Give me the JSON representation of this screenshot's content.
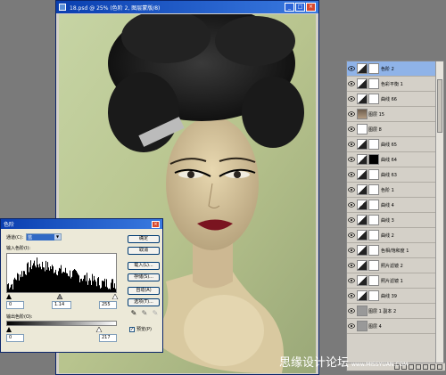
{
  "document": {
    "title": "18.psd @ 25% (色阶 2, 图层蒙版/8)",
    "controls": {
      "minimize": "_",
      "maximize": "□",
      "close": "×"
    }
  },
  "layers": {
    "items": [
      {
        "label": "色阶 2",
        "thumb": "adj",
        "mask": "white",
        "selected": true
      },
      {
        "label": "色彩平衡 1",
        "thumb": "adj",
        "mask": "white",
        "selected": false
      },
      {
        "label": "曲线 66",
        "thumb": "adj",
        "mask": "white",
        "selected": false
      },
      {
        "label": "图层 15",
        "thumb": "photo",
        "mask": "",
        "selected": false
      },
      {
        "label": "图层 8",
        "thumb": "blank",
        "mask": "",
        "selected": false
      },
      {
        "label": "曲线 65",
        "thumb": "adj",
        "mask": "white",
        "selected": false
      },
      {
        "label": "曲线 64",
        "thumb": "adj",
        "mask": "black",
        "selected": false
      },
      {
        "label": "曲线 63",
        "thumb": "adj",
        "mask": "white",
        "selected": false
      },
      {
        "label": "色阶 1",
        "thumb": "adj",
        "mask": "white",
        "selected": false
      },
      {
        "label": "曲线 4",
        "thumb": "adj",
        "mask": "white",
        "selected": false
      },
      {
        "label": "曲线 3",
        "thumb": "adj",
        "mask": "white",
        "selected": false
      },
      {
        "label": "曲线 2",
        "thumb": "adj",
        "mask": "white",
        "selected": false
      },
      {
        "label": "色相/饱和度 1",
        "thumb": "adj",
        "mask": "white",
        "selected": false
      },
      {
        "label": "照片滤镜 2",
        "thumb": "adj",
        "mask": "white",
        "selected": false
      },
      {
        "label": "照片滤镜 1",
        "thumb": "adj",
        "mask": "white",
        "selected": false
      },
      {
        "label": "曲线 39",
        "thumb": "adj",
        "mask": "white",
        "selected": false
      },
      {
        "label": "图层 1 副本 2",
        "thumb": "grey",
        "mask": "",
        "selected": false
      },
      {
        "label": "图层 4",
        "thumb": "grey",
        "mask": "",
        "selected": false
      }
    ]
  },
  "levels": {
    "title": "色阶",
    "close": "×",
    "channel_label": "通道(C):",
    "channel_value": "蓝",
    "input_label": "输入色阶(I):",
    "input_black": "0",
    "input_gamma": "1.14",
    "input_white": "255",
    "output_label": "输出色阶(O):",
    "output_black": "0",
    "output_white": "217",
    "buttons": {
      "ok": "确定",
      "cancel": "取消",
      "load": "载入(L)...",
      "save": "存储(S)...",
      "auto": "自动(A)",
      "options": "选项(T)..."
    },
    "preview_label": "预览(P)",
    "preview_checked": "✓",
    "eyedropper_glyph": "✎"
  },
  "watermark": {
    "text": "思缘设计论坛",
    "url": "www.MISSYUAN.COM"
  },
  "colors": {
    "selected_layer": "#8fb3e8",
    "titlebar": "#0a3fb0",
    "lip": "#7a1420"
  }
}
